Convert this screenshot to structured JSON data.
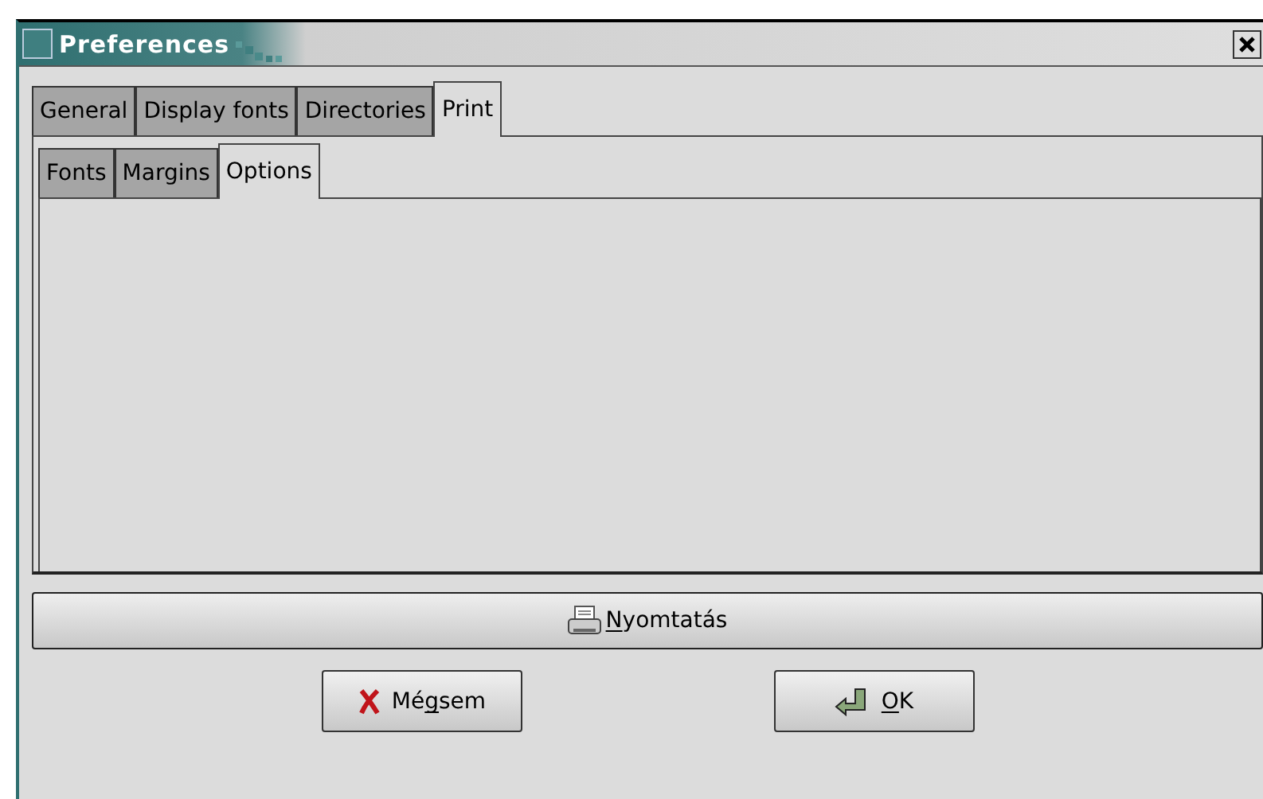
{
  "window": {
    "title": "Preferences"
  },
  "tabs": [
    {
      "label": "General",
      "selected": false
    },
    {
      "label": "Display fonts",
      "selected": false
    },
    {
      "label": "Directories",
      "selected": false
    },
    {
      "label": "Print",
      "selected": true
    }
  ],
  "subtabs": [
    {
      "label": "Fonts",
      "selected": false
    },
    {
      "label": "Margins",
      "selected": false
    },
    {
      "label": "Options",
      "selected": true
    }
  ],
  "print_button": {
    "label": [
      {
        "text": "N",
        "underlined": true
      },
      {
        "text": "yomtatás",
        "underlined": false
      }
    ]
  },
  "buttons": [
    {
      "kind": "cancel",
      "label": [
        {
          "text": "Mé",
          "underlined": false
        },
        {
          "text": "g",
          "underlined": true
        },
        {
          "text": "sem",
          "underlined": false
        }
      ]
    },
    {
      "kind": "ok",
      "label": [
        {
          "text": "O",
          "underlined": true
        },
        {
          "text": "K",
          "underlined": false
        }
      ]
    }
  ]
}
